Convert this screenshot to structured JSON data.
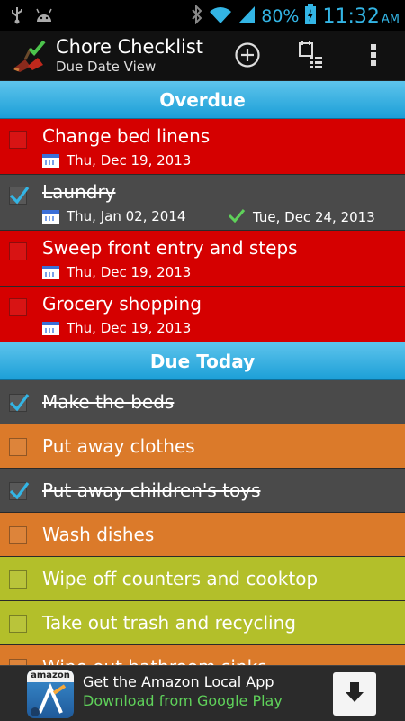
{
  "status_bar": {
    "battery_pct": "80%",
    "time": "11:32",
    "ampm": "AM"
  },
  "action_bar": {
    "title": "Chore Checklist",
    "subtitle": "Due Date View"
  },
  "sections": [
    {
      "header": "Overdue",
      "items": [
        {
          "label": "Change bed linens",
          "done": false,
          "due": "Thu, Dec 19, 2013",
          "completed": "",
          "color": "#d50000",
          "rows": "two"
        },
        {
          "label": "Laundry",
          "done": true,
          "due": "Thu, Jan 02, 2014",
          "completed": "Tue, Dec 24, 2013",
          "color": "#4a4a4a",
          "rows": "two"
        },
        {
          "label": "Sweep front entry and steps",
          "done": false,
          "due": "Thu, Dec 19, 2013",
          "completed": "",
          "color": "#d50000",
          "rows": "two"
        },
        {
          "label": "Grocery shopping",
          "done": false,
          "due": "Thu, Dec 19, 2013",
          "completed": "",
          "color": "#d50000",
          "rows": "two"
        }
      ]
    },
    {
      "header": "Due Today",
      "items": [
        {
          "label": "Make the beds",
          "done": true,
          "color": "#4a4a4a",
          "rows": "one"
        },
        {
          "label": "Put away clothes",
          "done": false,
          "color": "#db7a2a",
          "rows": "one"
        },
        {
          "label": "Put away children's toys",
          "done": true,
          "color": "#4a4a4a",
          "rows": "one"
        },
        {
          "label": "Wash dishes",
          "done": false,
          "color": "#db7a2a",
          "rows": "one"
        },
        {
          "label": "Wipe off counters and cooktop",
          "done": false,
          "color": "#b3bf2a",
          "rows": "one"
        },
        {
          "label": "Take out trash and recycling",
          "done": false,
          "color": "#b3bf2a",
          "rows": "one"
        },
        {
          "label": "Wipe out bathroom sinks",
          "done": false,
          "color": "#db7a2a",
          "rows": "one"
        }
      ]
    }
  ],
  "ad": {
    "brand": "amazon",
    "title": "Get the Amazon Local App",
    "subtitle": "Download from Google Play"
  }
}
